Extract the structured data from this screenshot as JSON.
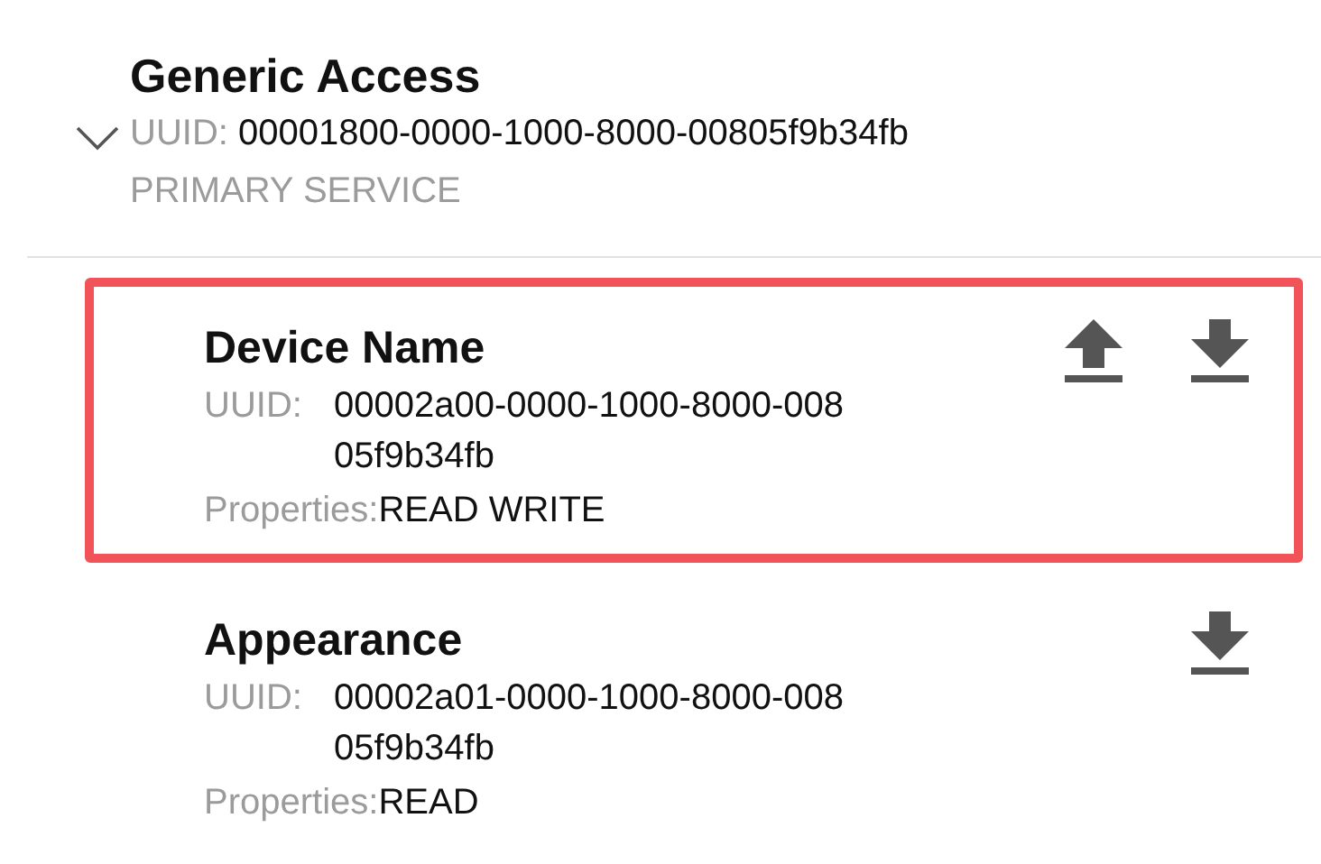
{
  "service": {
    "name": "Generic Access",
    "expanded": true,
    "uuid_label": "UUID:",
    "uuid": "00001800-0000-1000-8000-00805f9b34fb",
    "type": "PRIMARY SERVICE"
  },
  "characteristics": [
    {
      "name": "Device Name",
      "highlighted": true,
      "writable": true,
      "readable": true,
      "uuid_label": "UUID:",
      "uuid_lines": [
        "00002a00-0000-1000-8000-008",
        "05f9b34fb"
      ],
      "properties_label": "Properties:",
      "properties": "READ WRITE"
    },
    {
      "name": "Appearance",
      "highlighted": false,
      "writable": false,
      "readable": true,
      "uuid_label": "UUID:",
      "uuid_lines": [
        "00002a01-0000-1000-8000-008",
        "05f9b34fb"
      ],
      "properties_label": "Properties:",
      "properties": "READ"
    }
  ]
}
